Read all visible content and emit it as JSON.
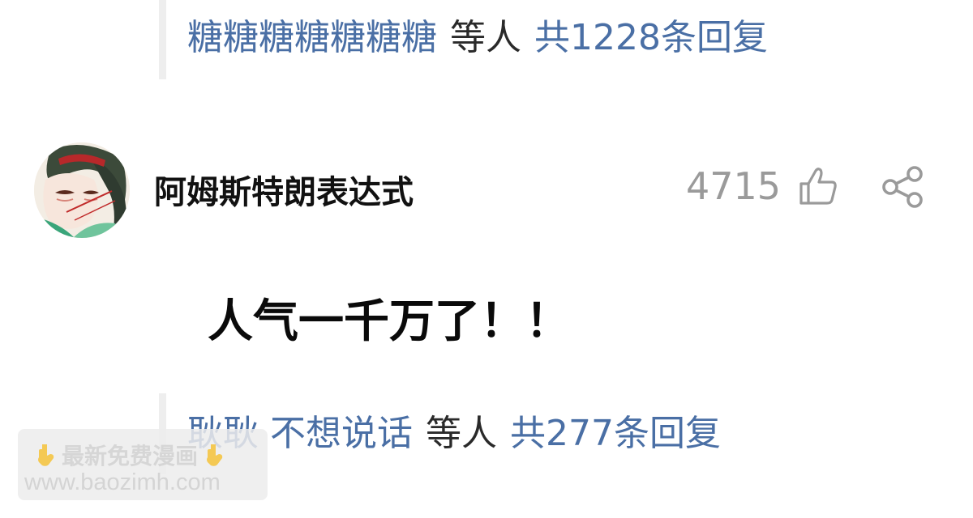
{
  "top_reply": {
    "names": "糖糖糖糖糖糖糖",
    "connector": "等人",
    "count_text": "共1228条回复"
  },
  "comment": {
    "avatar_icon": "avatar-illustration",
    "username": "阿姆斯特朗表达式",
    "like_count": "4715",
    "like_icon": "thumbs-up-icon",
    "share_icon": "share-icon",
    "text": "人气一千万了！！"
  },
  "bottom_reply": {
    "names": "耿耿 不想说话",
    "connector": "等人",
    "count_text": "共277条回复"
  },
  "watermark": {
    "line1": "最新免费漫画",
    "line2": "www.baozimh.com"
  },
  "colors": {
    "link": "#4a6fa5",
    "muted": "#9a9a9a",
    "text": "#111111"
  }
}
